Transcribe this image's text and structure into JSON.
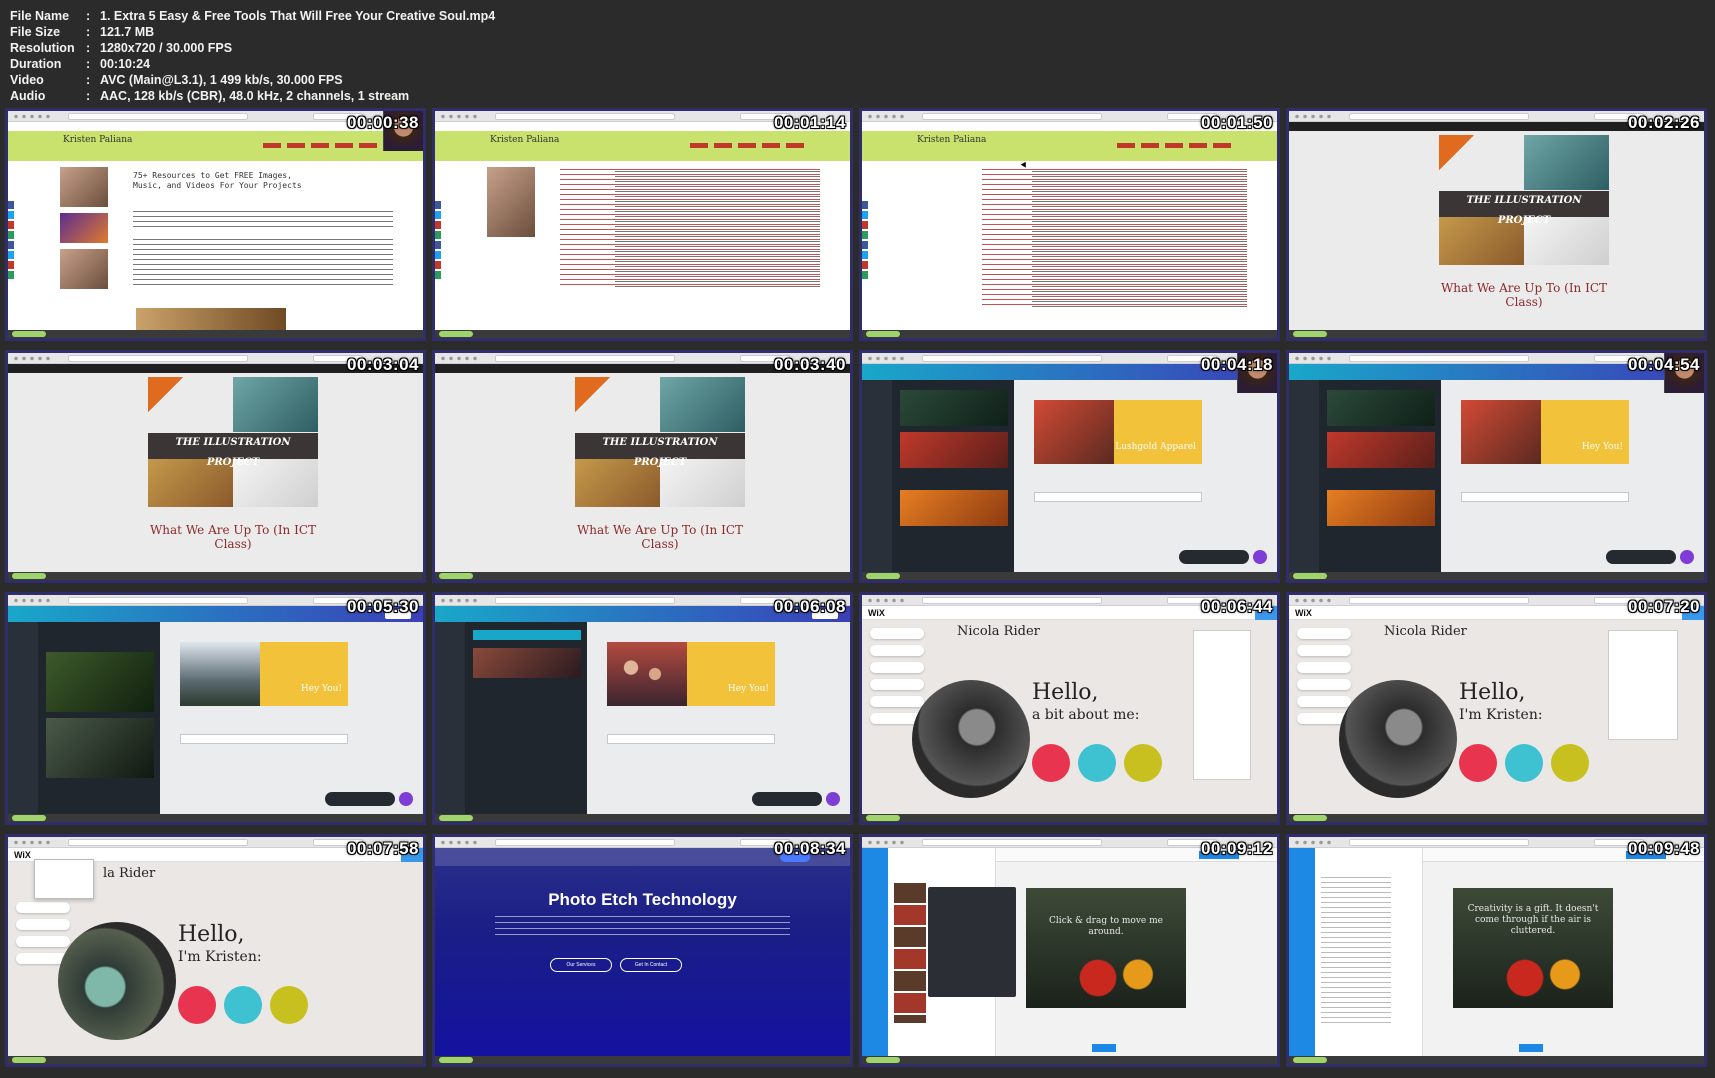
{
  "info": {
    "rows": [
      {
        "key": "File Name",
        "value": "1. Extra 5 Easy & Free Tools That Will Free Your Creative Soul.mp4"
      },
      {
        "key": "File Size",
        "value": "121.7 MB"
      },
      {
        "key": "Resolution",
        "value": "1280x720 / 30.000 FPS"
      },
      {
        "key": "Duration",
        "value": "00:10:24"
      },
      {
        "key": "Video",
        "value": "AVC (Main@L3.1), 1 499 kb/s, 30.000 FPS"
      },
      {
        "key": "Audio",
        "value": "AAC, 128 kb/s (CBR), 48.0 kHz, 2 channels, 1 stream"
      }
    ]
  },
  "thumbs": [
    {
      "time": "00:00:38"
    },
    {
      "time": "00:01:14"
    },
    {
      "time": "00:01:50"
    },
    {
      "time": "00:02:26"
    },
    {
      "time": "00:03:04"
    },
    {
      "time": "00:03:40"
    },
    {
      "time": "00:04:18"
    },
    {
      "time": "00:04:54"
    },
    {
      "time": "00:05:30"
    },
    {
      "time": "00:06:08"
    },
    {
      "time": "00:06:44"
    },
    {
      "time": "00:07:20"
    },
    {
      "time": "00:07:58"
    },
    {
      "time": "00:08:34"
    },
    {
      "time": "00:09:12"
    },
    {
      "time": "00:09:48"
    }
  ],
  "blog": {
    "author": "Kristen Paliana",
    "post_title": "75+ Resources to Get FREE Images, Music, and Videos For Your Projects"
  },
  "illustration": {
    "band_title": "THE ILLUSTRATION PROJECT",
    "caption": "What We Are Up To (In ICT Class)"
  },
  "canva": {
    "card_text_1": "Lushgold Apparel",
    "card_text_2": "Hey You!"
  },
  "wix": {
    "logo": "WiX",
    "name": "Nicola Rider",
    "name_partial": "la Rider",
    "hello": "Hello,",
    "sub1": "a bit about me:",
    "sub2": "I'm Kristen:"
  },
  "etch": {
    "title": "Photo Etch Technology",
    "btn1": "Our Services",
    "btn2": "Get In Contact"
  },
  "stencil": {
    "drag_text": "Click & drag to move me around.",
    "quote": "Creativity is a gift. It doesn't come through if the air is cluttered."
  }
}
